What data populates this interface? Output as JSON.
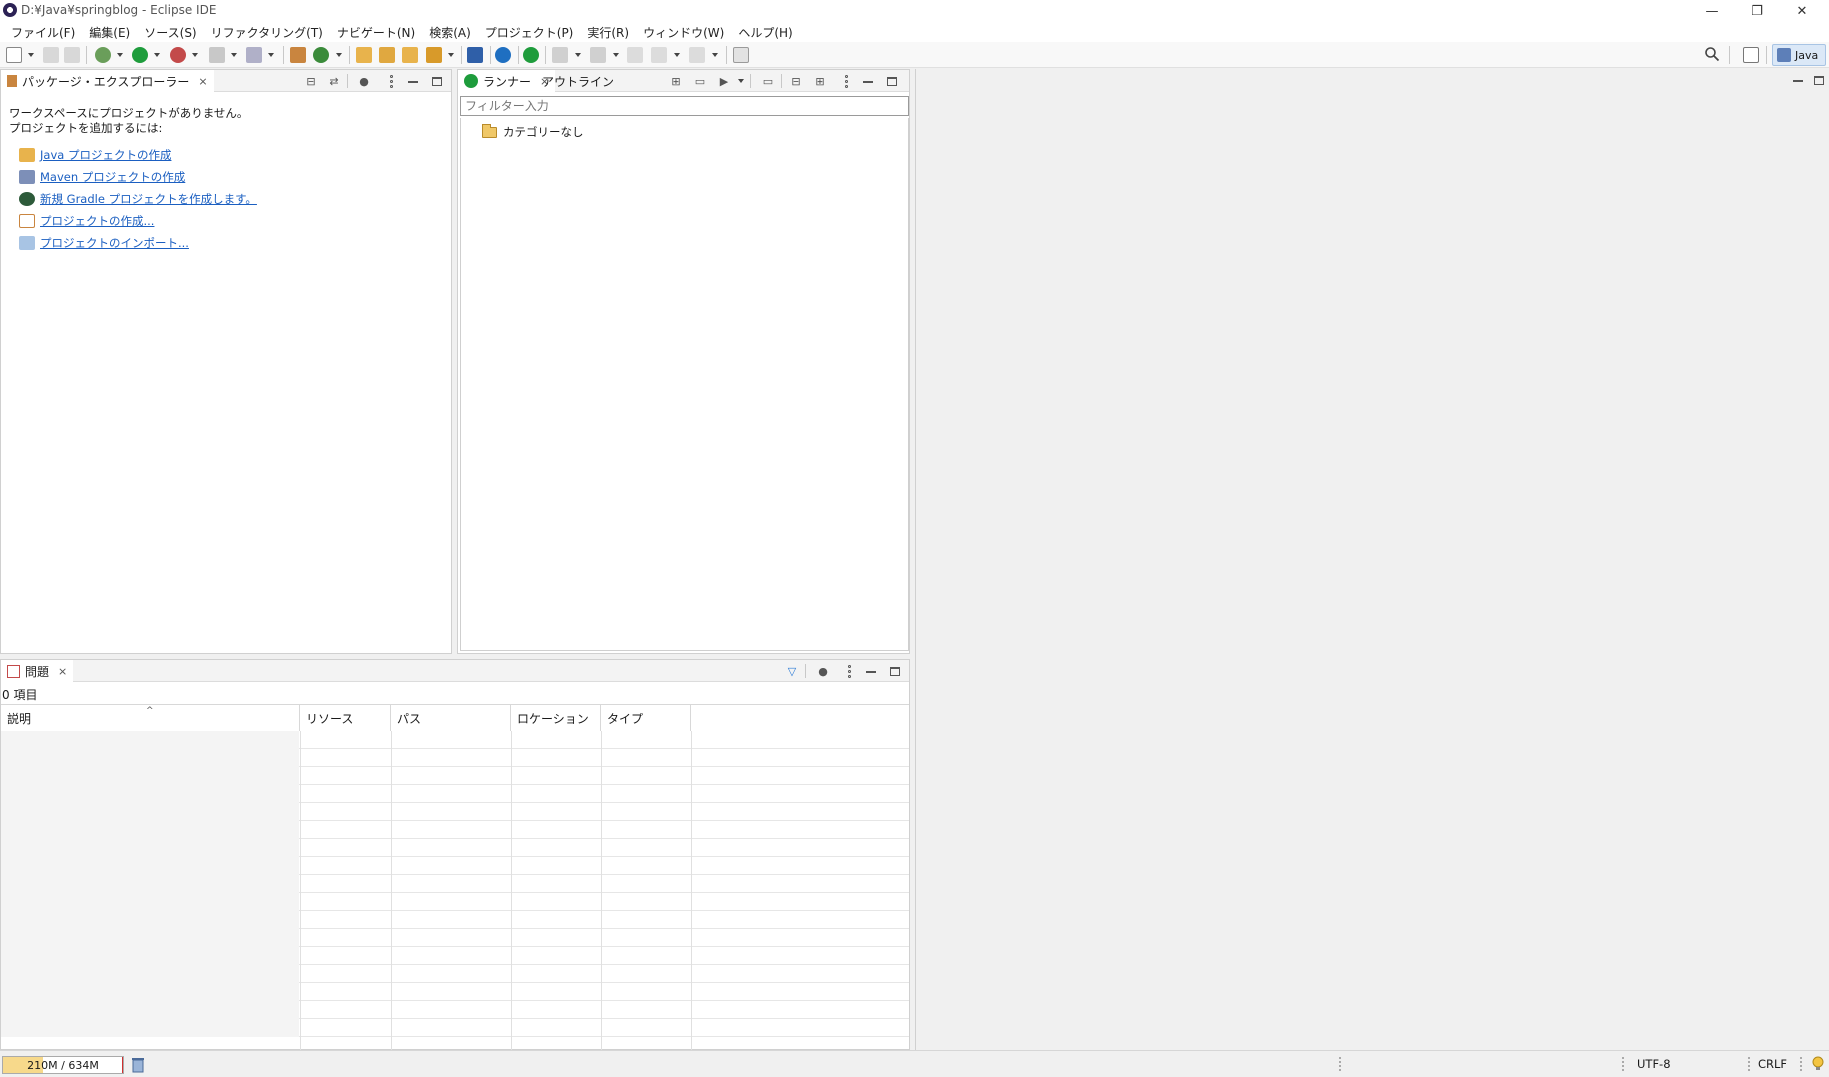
{
  "window": {
    "title": "D:¥Java¥springblog - Eclipse IDE",
    "controls": {
      "minimize": "—",
      "restore": "❐",
      "close": "✕"
    }
  },
  "menu": [
    "ファイル(F)",
    "編集(E)",
    "ソース(S)",
    "リファクタリング(T)",
    "ナビゲート(N)",
    "検索(A)",
    "プロジェクト(P)",
    "実行(R)",
    "ウィンドウ(W)",
    "ヘルプ(H)"
  ],
  "perspective": {
    "label": "Java"
  },
  "package_explorer": {
    "tab_label": "パッケージ・エクスプローラー",
    "message_line1": "ワークスペースにプロジェクトがありません。",
    "message_line2": "プロジェクトを追加するには:",
    "links": [
      "Java プロジェクトの作成",
      "Maven プロジェクトの作成",
      "新規 Gradle プロジェクトを作成します。",
      "プロジェクトの作成...",
      "プロジェクトのインポート..."
    ]
  },
  "runner": {
    "tab_runner": "ランナー",
    "tab_outline": "アウトライン",
    "filter_placeholder": "フィルター入力",
    "tree_item": "カテゴリーなし"
  },
  "problems": {
    "tab_label": "問題",
    "count": "0 項目",
    "columns": [
      "説明",
      "リソース",
      "パス",
      "ロケーション",
      "タイプ"
    ]
  },
  "status": {
    "heap": "210M / 634M",
    "heap_used_fraction": 0.33,
    "encoding": "UTF-8",
    "line_ending": "CRLF"
  },
  "colors": {
    "link": "#1b5fc1",
    "run_green": "#1e9c3c",
    "perspective_bg": "#dbe8f7",
    "heap_fill": "#f7d98b"
  }
}
